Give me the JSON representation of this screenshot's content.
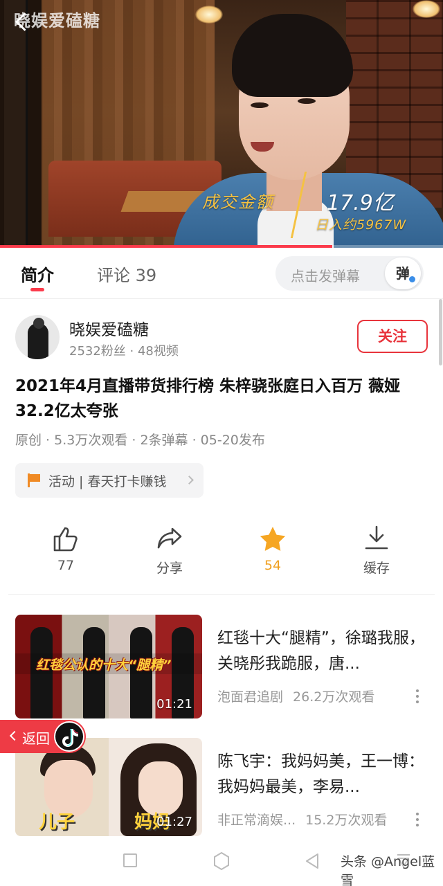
{
  "player": {
    "watermark": "晓娱爱磕糖",
    "overlay_label": "成交金额",
    "overlay_value": "17.9亿",
    "overlay_sub": "日入约5967W",
    "progress_fraction": 0.75
  },
  "tabs": {
    "intro": "简介",
    "comments": "评论 39"
  },
  "danmaku": {
    "placeholder": "点击发弹幕",
    "button": "弹"
  },
  "author": {
    "name": "晓娱爱磕糖",
    "stats": "2532粉丝 · 48视频",
    "follow": "关注"
  },
  "video": {
    "title": "2021年4月直播带货排行榜 朱梓骁张庭日入百万 薇娅32.2亿太夸张",
    "meta": "原创 · 5.3万次观看 · 2条弹幕 · 05-20发布"
  },
  "activity": {
    "text": "活动 | 春天打卡赚钱"
  },
  "actions": {
    "like_count": "77",
    "share": "分享",
    "favorite_count": "54",
    "cache": "缓存"
  },
  "related": [
    {
      "thumb_caption": "红毯公认的十大“腿精”",
      "duration": "01:21",
      "title": "红毯十大“腿精”，徐璐我服，关晓彤我跪服，唐...",
      "channel": "泡面君追剧",
      "views": "26.2万次观看"
    },
    {
      "thumb_tag_left": "儿子",
      "thumb_tag_right": "妈妈",
      "duration": "01:27",
      "title": "陈飞宇：我妈妈美，王一博：我妈妈最美，李易...",
      "channel": "非正常滴娱...",
      "views": "15.2万次观看"
    }
  ],
  "return_pill": {
    "label": "返回"
  },
  "credit": "头条 @Angel蓝雪",
  "colors": {
    "accent": "#fb3b4b",
    "gold": "#f0a020"
  }
}
